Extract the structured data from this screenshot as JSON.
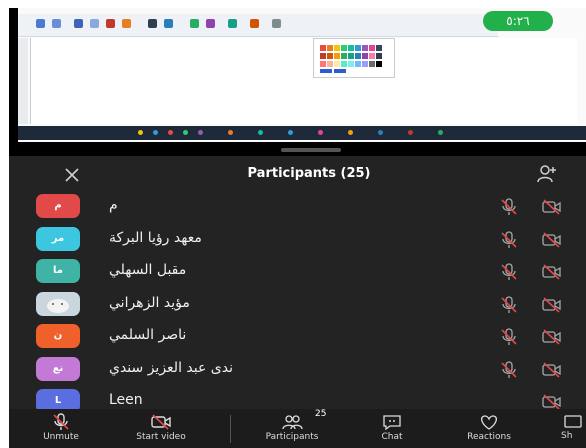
{
  "timer": "٥:٢٦",
  "panel": {
    "title": "Participants (25)"
  },
  "participants": [
    {
      "initials": "م",
      "name": "م",
      "color": "#e24a4a",
      "mic_muted": true,
      "video_off": true
    },
    {
      "initials": "مر",
      "name": "معهد رؤيا البركة",
      "color": "#3cc6e0",
      "mic_muted": true,
      "video_off": true
    },
    {
      "initials": "ما",
      "name": "مقبل السهلي",
      "color": "#3fb3a6",
      "mic_muted": true,
      "video_off": true
    },
    {
      "initials": "",
      "name": "مؤيد الزهراني",
      "color": "#c9d6de",
      "mic_muted": true,
      "video_off": true
    },
    {
      "initials": "ن",
      "name": "ناصر السلمي",
      "color": "#f0602a",
      "mic_muted": true,
      "video_off": true
    },
    {
      "initials": "نع",
      "name": "ندى عبد العزيز سندي",
      "color": "#c27ad6",
      "mic_muted": true,
      "video_off": true
    },
    {
      "initials": "L",
      "name": "Leen",
      "color": "#5b6ee0",
      "mic_muted": false,
      "video_off": true
    }
  ],
  "bottom_bar": {
    "unmute": "Unmute",
    "start_video": "Start video",
    "participants": "Participants",
    "participants_count": "25",
    "chat": "Chat",
    "reactions": "Reactions",
    "share": "Sh"
  }
}
